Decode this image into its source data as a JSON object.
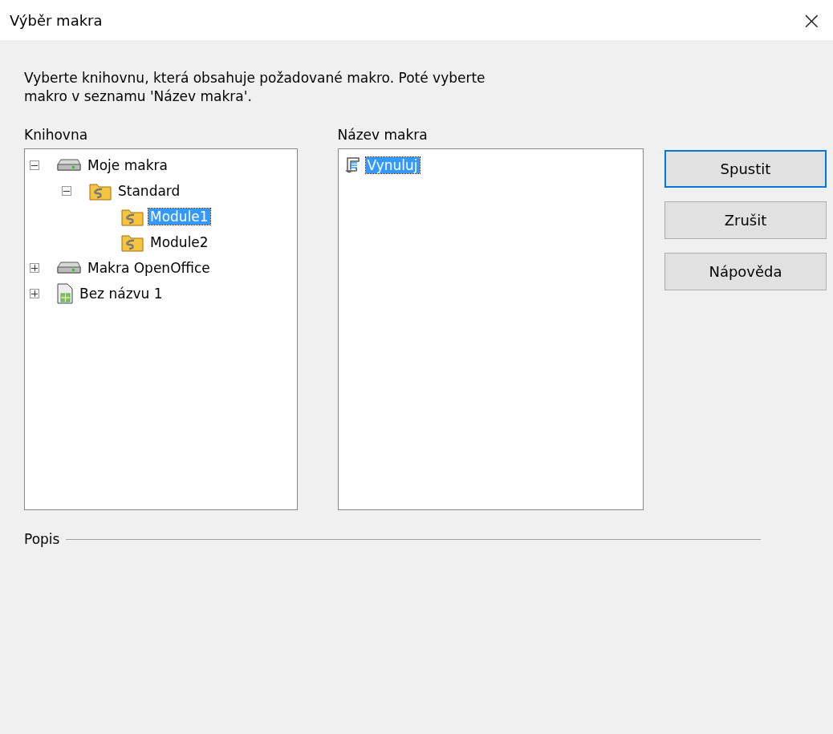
{
  "window": {
    "title": "Výběr makra",
    "close": "×"
  },
  "description": "Vyberte knihovnu, která obsahuje požadované makro. Poté vyberte makro v seznamu 'Název makra'.",
  "library": {
    "label": "Knihovna",
    "tree": [
      {
        "kind": "library",
        "label": "Moje makra",
        "expanded": true,
        "selected": false,
        "children": [
          {
            "kind": "folder",
            "label": "Standard",
            "expanded": true,
            "selected": false,
            "children": [
              {
                "kind": "module",
                "label": "Module1",
                "selected": true
              },
              {
                "kind": "module",
                "label": "Module2",
                "selected": false
              }
            ]
          }
        ]
      },
      {
        "kind": "library",
        "label": "Makra OpenOffice",
        "expanded": false,
        "selected": false
      },
      {
        "kind": "document",
        "label": "Bez názvu 1",
        "expanded": false,
        "selected": false
      }
    ]
  },
  "macros": {
    "label": "Název makra",
    "items": [
      {
        "label": "Vynuluj",
        "selected": true
      }
    ]
  },
  "buttons": [
    {
      "label": "Spustit",
      "focused": true
    },
    {
      "label": "Zrušit",
      "focused": false
    },
    {
      "label": "Nápověda",
      "focused": false
    }
  ],
  "popis": {
    "label": "Popis"
  }
}
